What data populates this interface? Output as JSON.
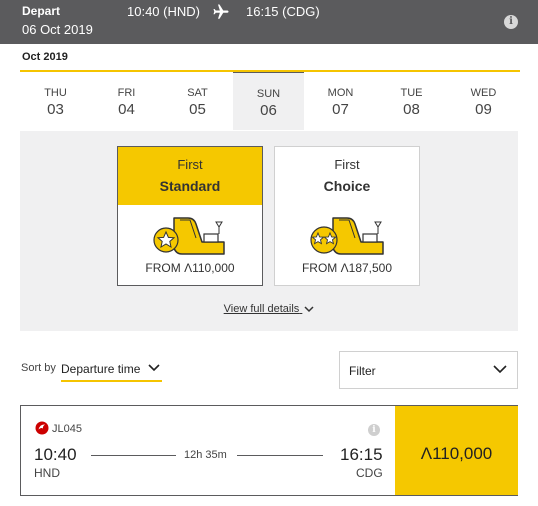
{
  "header": {
    "depart_label": "Depart",
    "date": "06 Oct 2019",
    "dep_time": "10:40 (HND)",
    "arr_time": "16:15 (CDG)",
    "info_glyph": "i",
    "plane_icon": "airplane-icon"
  },
  "calendar": {
    "month": "Oct 2019",
    "days": [
      {
        "name": "THU",
        "num": "03"
      },
      {
        "name": "FRI",
        "num": "04"
      },
      {
        "name": "SAT",
        "num": "05"
      },
      {
        "name": "SUN",
        "num": "06"
      },
      {
        "name": "MON",
        "num": "07"
      },
      {
        "name": "TUE",
        "num": "08"
      },
      {
        "name": "WED",
        "num": "09"
      }
    ],
    "selected_index": 3
  },
  "fares": [
    {
      "sub": "First",
      "name": "Standard",
      "price": "FROM Λ110,000",
      "stars": 1
    },
    {
      "sub": "First",
      "name": "Choice",
      "price": "FROM Λ187,500",
      "stars": 2
    }
  ],
  "view_details": "View full details",
  "sort": {
    "label": "Sort by",
    "value": "Departure time"
  },
  "filter": {
    "label": "Filter"
  },
  "flight": {
    "number": "JL045",
    "dep_time": "10:40",
    "dep_code": "HND",
    "duration": "12h 35m",
    "arr_time": "16:15",
    "arr_code": "CDG",
    "price": "Λ110,000",
    "info_glyph": "i"
  },
  "colors": {
    "header_bg": "#5b5b5d",
    "accent": "#f5c800",
    "panel_bg": "#f0f0f1",
    "logo_red": "#cc0000"
  }
}
